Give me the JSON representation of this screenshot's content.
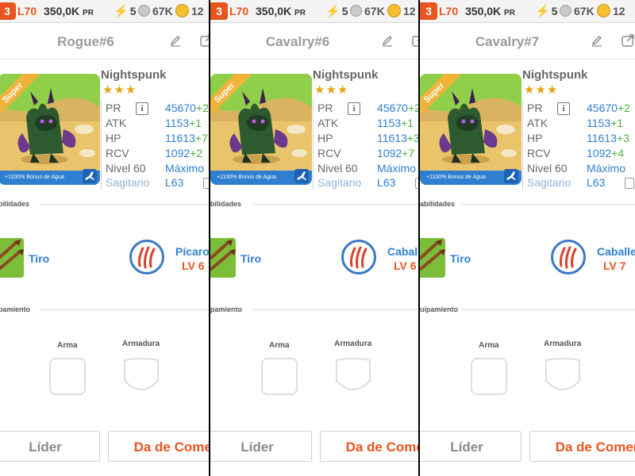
{
  "panels": [
    {
      "status": {
        "level_badge": "3",
        "player_level": "L70",
        "power": "350,0K",
        "power_unit": "PR",
        "energy": "5",
        "gems": "67K",
        "coins": "12"
      },
      "title": "Rogue#6",
      "monster": {
        "name": "Nightspunk",
        "stars": "★★★",
        "ribbon": "Super",
        "bonus": "+1100% Bonus de Agua"
      },
      "stats": {
        "pr_label": "PR",
        "pr_value": "45670",
        "pr_bonus": "+2",
        "atk_label": "ATK",
        "atk_value": "1153",
        "atk_bonus": "+1",
        "hp_label": "HP",
        "hp_value": "11613",
        "hp_bonus": "+7",
        "rcv_label": "RCV",
        "rcv_value": "1092",
        "rcv_bonus": "+2",
        "level_label": "Nivel 60",
        "level_value": "Máximo",
        "zodiac_label": "Sagitario",
        "zodiac_value": "L63"
      },
      "abilities_label": "bilidades",
      "skill": {
        "name": "Tiro"
      },
      "class": {
        "name": "Pícaro",
        "level": "LV 6"
      },
      "equipment_label": "pamiento",
      "weapon_label": "Arma",
      "armor_label": "Armadura",
      "leader_button": "Líder",
      "feed_button": "Da de Comer"
    },
    {
      "status": {
        "level_badge": "3",
        "player_level": "L70",
        "power": "350,0K",
        "power_unit": "PR",
        "energy": "5",
        "gems": "67K",
        "coins": "12"
      },
      "title": "Cavalry#6",
      "monster": {
        "name": "Nightspunk",
        "stars": "★★★",
        "ribbon": "Super",
        "bonus": "+1100% Bonus de Agua"
      },
      "stats": {
        "pr_label": "PR",
        "pr_value": "45670",
        "pr_bonus": "+2",
        "atk_label": "ATK",
        "atk_value": "1153",
        "atk_bonus": "+1",
        "hp_label": "HP",
        "hp_value": "11613",
        "hp_bonus": "+3",
        "rcv_label": "RCV",
        "rcv_value": "1092",
        "rcv_bonus": "+7",
        "level_label": "Nivel 60",
        "level_value": "Máximo",
        "zodiac_label": "Sagitario",
        "zodiac_value": "L63"
      },
      "abilities_label": "bilidades",
      "skill": {
        "name": "Tiro"
      },
      "class": {
        "name": "Caballe",
        "level": "LV 6"
      },
      "equipment_label": "pamiento",
      "weapon_label": "Arma",
      "armor_label": "Armadura",
      "leader_button": "Líder",
      "feed_button": "Da de Comer"
    },
    {
      "status": {
        "level_badge": "3",
        "player_level": "L70",
        "power": "350,0K",
        "power_unit": "PR",
        "energy": "5",
        "gems": "67K",
        "coins": "12"
      },
      "title": "Cavalry#7",
      "monster": {
        "name": "Nightspunk",
        "stars": "★★★",
        "ribbon": "Super",
        "bonus": "+1100% Bonus de Agua"
      },
      "stats": {
        "pr_label": "PR",
        "pr_value": "45670",
        "pr_bonus": "+2",
        "atk_label": "ATK",
        "atk_value": "1153",
        "atk_bonus": "+1",
        "hp_label": "HP",
        "hp_value": "11613",
        "hp_bonus": "+3",
        "rcv_label": "RCV",
        "rcv_value": "1092",
        "rcv_bonus": "+4",
        "level_label": "Nivel 60",
        "level_value": "Máximo",
        "zodiac_label": "Sagitario",
        "zodiac_value": "L63"
      },
      "abilities_label": "abilidades",
      "skill": {
        "name": "Tiro"
      },
      "class": {
        "name": "Caballe",
        "level": "LV 7"
      },
      "equipment_label": "uipamiento",
      "weapon_label": "Arma",
      "armor_label": "Armadura",
      "leader_button": "Líder",
      "feed_button": "Da de Comer"
    }
  ],
  "colors": {
    "accent_orange": "#e8541e",
    "stat_blue": "#2f7fd0",
    "bonus_green": "#4db33d",
    "star_gold": "#e6a415"
  }
}
